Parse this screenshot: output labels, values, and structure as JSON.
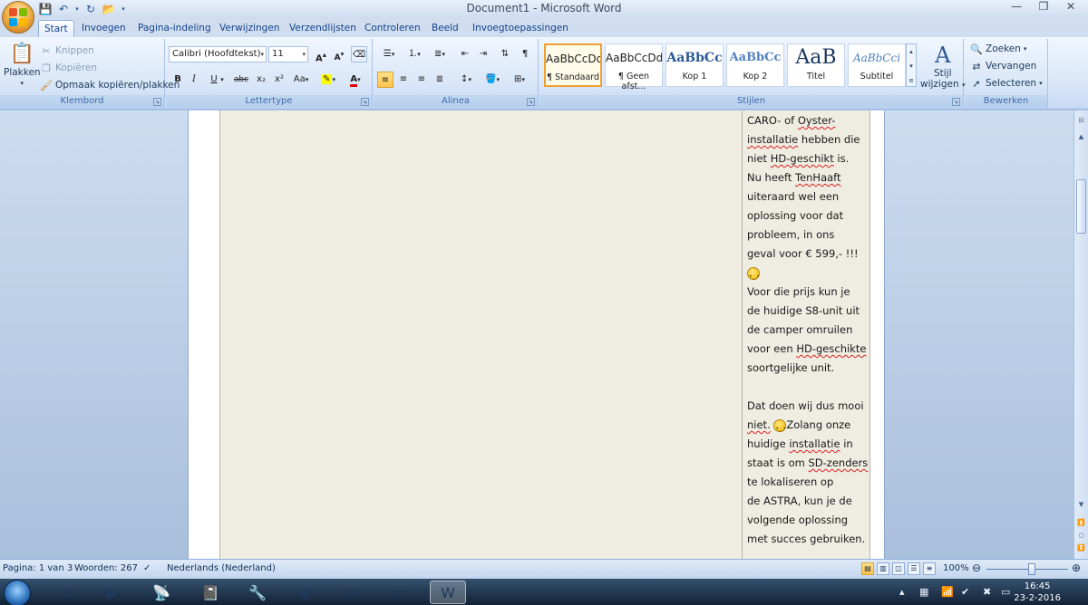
{
  "window": {
    "title": "Document1 - Microsoft Word",
    "controls": [
      "—",
      "❐",
      "✕"
    ]
  },
  "tabs": [
    "Start",
    "Invoegen",
    "Pagina-indeling",
    "Verwijzingen",
    "Verzendlijsten",
    "Controleren",
    "Beeld",
    "Invoegtoepassingen"
  ],
  "ribbon": {
    "clipboard": {
      "label": "Klembord",
      "paste": "Plakken",
      "cut": "Knippen",
      "copy": "Kopiëren",
      "format_painter": "Opmaak kopiëren/plakken"
    },
    "font": {
      "label": "Lettertype",
      "name": "Calibri (Hoofdtekst)",
      "size": "11",
      "grow": "A",
      "shrink": "A",
      "bold": "B",
      "italic": "I",
      "underline": "U",
      "strike": "abc",
      "subscript": "x₂",
      "superscript": "x²",
      "case": "Aa",
      "font_color": "A"
    },
    "paragraph": {
      "label": "Alinea"
    },
    "styles": {
      "label": "Stijlen",
      "items": [
        {
          "preview": "AaBbCcDd",
          "name": "¶ Standaard"
        },
        {
          "preview": "AaBbCcDd",
          "name": "¶ Geen afst..."
        },
        {
          "preview": "AaBbCc",
          "name": "Kop 1"
        },
        {
          "preview": "AaBbCc",
          "name": "Kop 2"
        },
        {
          "preview": "AaB",
          "name": "Titel"
        },
        {
          "preview": "AaBbCci",
          "name": "Subtitel"
        }
      ],
      "change_styles": "Stijl",
      "change_styles_2": "wijzigen"
    },
    "editing": {
      "label": "Bewerken",
      "find": "Zoeken",
      "replace": "Vervangen",
      "select": "Selecteren"
    }
  },
  "document": {
    "lines": [
      "CARO- of Oyster-",
      "installatie hebben die",
      "niet HD-geschikt is.",
      "Nu heeft TenHaaft",
      "uiteraard wel een",
      "oplossing voor dat",
      "probleem, in ons",
      "geval voor € 599,- !!!",
      "",
      "Voor die prijs kun je",
      "de huidige S8-unit uit",
      "de camper omruilen",
      "voor een HD-geschikte",
      "soortgelijke unit.",
      "",
      "Dat doen wij dus mooi",
      "niet.",
      "Zolang onze",
      "huidige installatie in",
      "staat is om SD-zenders",
      "te lokaliseren op",
      "de ASTRA, kun je de",
      "volgende oplossing",
      "met succes gebruiken."
    ]
  },
  "status": {
    "page": "Pagina: 1 van 3",
    "words": "Woorden: 267",
    "language": "Nederlands (Nederland)",
    "zoom": "100%",
    "zoom_level": 0.55
  },
  "taskbar": {
    "time": "16:45",
    "date": "23-2-2016"
  }
}
